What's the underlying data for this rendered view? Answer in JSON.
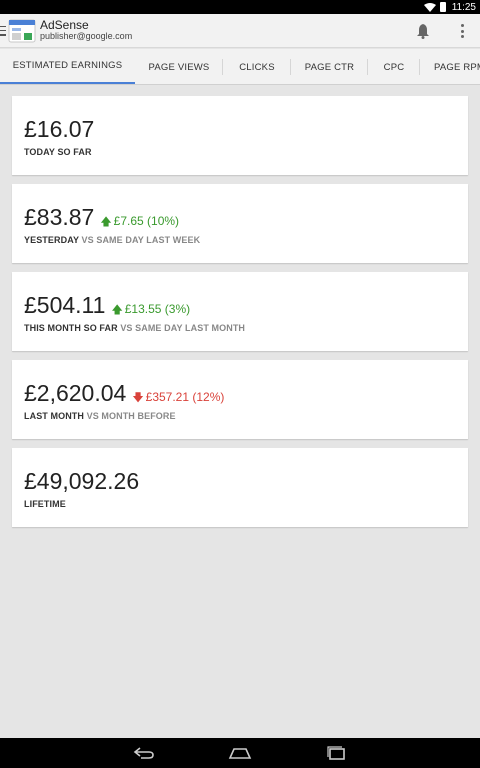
{
  "status_bar": {
    "time": "11:25"
  },
  "app": {
    "title": "AdSense",
    "account": "publisher@google.com"
  },
  "tabs": [
    {
      "label": "ESTIMATED EARNINGS",
      "active": true
    },
    {
      "label": "PAGE VIEWS",
      "active": false
    },
    {
      "label": "CLICKS",
      "active": false
    },
    {
      "label": "PAGE CTR",
      "active": false
    },
    {
      "label": "CPC",
      "active": false
    },
    {
      "label": "PAGE RPM",
      "active": false
    }
  ],
  "cards": [
    {
      "value": "£16.07",
      "delta": "",
      "direction": "",
      "label": "TODAY SO FAR",
      "comparison": ""
    },
    {
      "value": "£83.87",
      "delta": "£7.65 (10%)",
      "direction": "up",
      "label": "YESTERDAY",
      "comparison": "VS SAME DAY LAST WEEK"
    },
    {
      "value": "£504.11",
      "delta": "£13.55 (3%)",
      "direction": "up",
      "label": "THIS MONTH SO FAR",
      "comparison": "VS SAME DAY LAST MONTH"
    },
    {
      "value": "£2,620.04",
      "delta": "£357.21 (12%)",
      "direction": "down",
      "label": "LAST MONTH",
      "comparison": "VS MONTH BEFORE"
    },
    {
      "value": "£49,092.26",
      "delta": "",
      "direction": "",
      "label": "LIFETIME",
      "comparison": ""
    }
  ],
  "colors": {
    "accent": "#4a80d6",
    "positive": "#3a9a2e",
    "negative": "#d9423a"
  },
  "icons": {
    "up_arrow": "arrow-up-icon",
    "down_arrow": "arrow-down-icon"
  }
}
